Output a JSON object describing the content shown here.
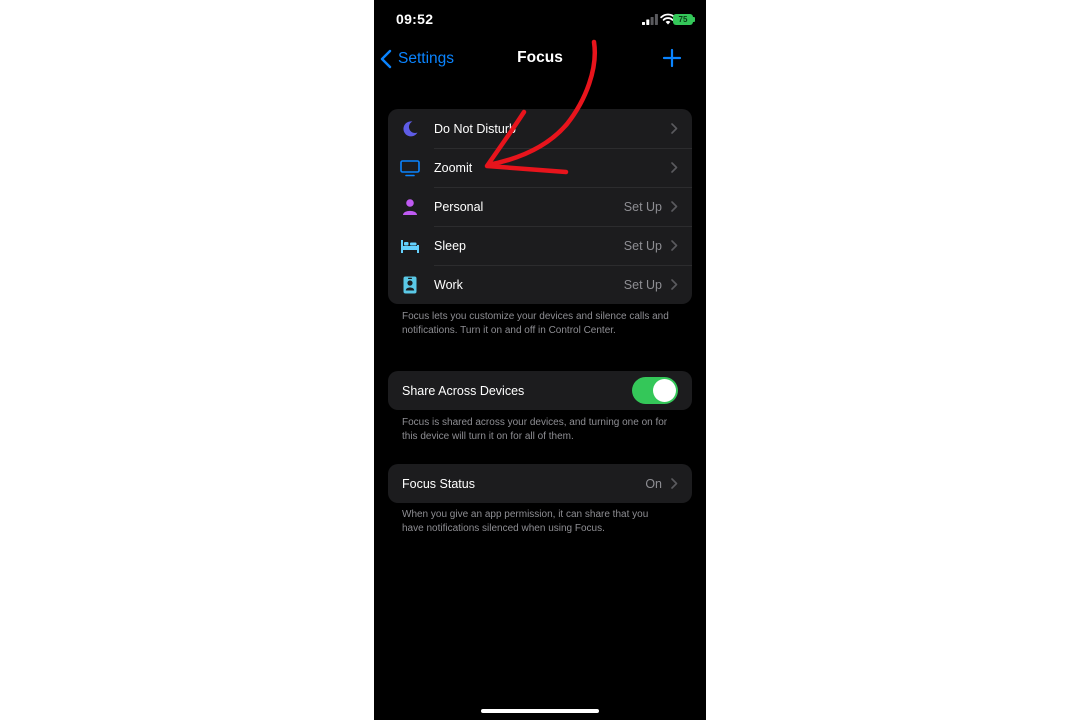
{
  "status_bar": {
    "time": "09:52",
    "battery": "75"
  },
  "nav": {
    "back_label": "Settings",
    "title": "Focus"
  },
  "focus_modes": [
    {
      "label": "Do Not Disturb",
      "value": "",
      "icon": "moon-icon",
      "color": "#5e5ce6"
    },
    {
      "label": "Zoomit",
      "value": "",
      "icon": "monitor-icon",
      "color": "#0a84ff"
    },
    {
      "label": "Personal",
      "value": "Set Up",
      "icon": "person-icon",
      "color": "#bf5af2"
    },
    {
      "label": "Sleep",
      "value": "Set Up",
      "icon": "bed-icon",
      "color": "#64d2ff"
    },
    {
      "label": "Work",
      "value": "Set Up",
      "icon": "id-badge-icon",
      "color": "#5ac8e6"
    }
  ],
  "focus_note": "Focus lets you customize your devices and silence calls and notifications. Turn it on and off in Control Center.",
  "share": {
    "label": "Share Across Devices",
    "enabled": true,
    "note": "Focus is shared across your devices, and turning one on for this device will turn it on for all of them."
  },
  "focus_status": {
    "label": "Focus Status",
    "value": "On",
    "note": "When you give an app permission, it can share that you have notifications silenced when using Focus."
  },
  "colors": {
    "accent": "#0a84ff",
    "toggle_on": "#34c759",
    "annotation_arrow": "#e8141c"
  }
}
